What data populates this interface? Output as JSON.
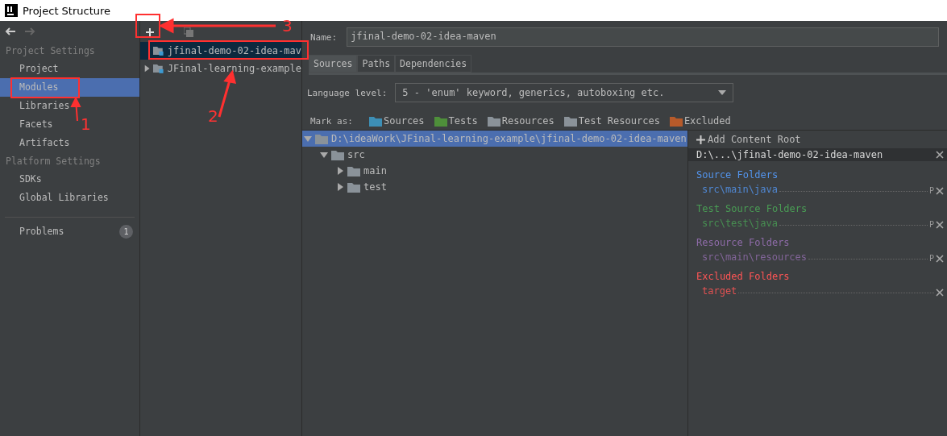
{
  "window": {
    "title": "Project Structure"
  },
  "sidebar": {
    "sections": [
      {
        "heading": "Project Settings",
        "items": [
          {
            "label": "Project",
            "selected": false
          },
          {
            "label": "Modules",
            "selected": true
          },
          {
            "label": "Libraries",
            "selected": false
          },
          {
            "label": "Facets",
            "selected": false
          },
          {
            "label": "Artifacts",
            "selected": false
          }
        ]
      },
      {
        "heading": "Platform Settings",
        "items": [
          {
            "label": "SDKs",
            "selected": false
          },
          {
            "label": "Global Libraries",
            "selected": false
          }
        ]
      }
    ],
    "problems": {
      "label": "Problems",
      "count": "1"
    }
  },
  "modules": {
    "items": [
      {
        "label": "jfinal-demo-02-idea-mav",
        "selected": true,
        "expandable": false
      },
      {
        "label": "JFinal-learning-example",
        "selected": false,
        "expandable": true
      }
    ]
  },
  "name_field": {
    "label": "Name:",
    "value": "jfinal-demo-02-idea-maven"
  },
  "tabs": [
    {
      "label": "Sources",
      "selected": true
    },
    {
      "label": "Paths",
      "selected": false
    },
    {
      "label": "Dependencies",
      "selected": false
    }
  ],
  "language_level": {
    "label": "Language level:",
    "value": "5 - 'enum' keyword, generics, autoboxing etc."
  },
  "mark_as": {
    "label": "Mark as:",
    "options": [
      {
        "label": "Sources",
        "kind": "sources"
      },
      {
        "label": "Tests",
        "kind": "tests"
      },
      {
        "label": "Resources",
        "kind": "resources"
      },
      {
        "label": "Test Resources",
        "kind": "test_resources"
      },
      {
        "label": "Excluded",
        "kind": "excluded"
      }
    ]
  },
  "tree": {
    "label": "D:\\ideaWork\\JFinal-learning-example\\jfinal-demo-02-idea-maven",
    "expanded": true,
    "selected": true,
    "children": [
      {
        "label": "src",
        "expanded": true,
        "selected": false,
        "children": [
          {
            "label": "main",
            "expanded": false,
            "selected": false
          },
          {
            "label": "test",
            "expanded": false,
            "selected": false
          }
        ]
      }
    ]
  },
  "content_root": {
    "add_label": "Add Content Root",
    "path": "D:\\...\\jfinal-demo-02-idea-maven",
    "groups": [
      {
        "kind": "source",
        "title": "Source Folders",
        "folders": [
          {
            "path": "src\\main\\java",
            "package_prefix": "P"
          }
        ]
      },
      {
        "kind": "test",
        "title": "Test Source Folders",
        "folders": [
          {
            "path": "src\\test\\java",
            "package_prefix": "P"
          }
        ]
      },
      {
        "kind": "resource",
        "title": "Resource Folders",
        "folders": [
          {
            "path": "src\\main\\resources",
            "package_prefix": "P"
          }
        ]
      },
      {
        "kind": "excluded",
        "title": "Excluded Folders",
        "folders": [
          {
            "path": "target"
          }
        ]
      }
    ]
  },
  "annotations": [
    {
      "label": "1"
    },
    {
      "label": "2"
    },
    {
      "label": "3"
    }
  ]
}
